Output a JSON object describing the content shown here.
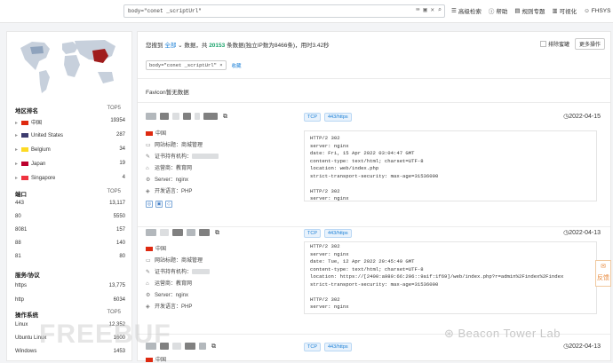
{
  "topbar": {
    "query": "body=\"conet _scriptUrl\"",
    "nav": [
      "高级检索",
      "帮助",
      "规则专题",
      "可视化",
      "FHSYS"
    ]
  },
  "sidebar": {
    "region": {
      "title": "地区排名",
      "top": "TOP5",
      "items": [
        {
          "name": "中国",
          "count": "19354",
          "flag": "#de2910"
        },
        {
          "name": "United States",
          "count": "287",
          "flag": "#3c3b6e"
        },
        {
          "name": "Belgium",
          "count": "34",
          "flag": "#fdda24"
        },
        {
          "name": "Japan",
          "count": "19",
          "flag": "#bc002d"
        },
        {
          "name": "Singapore",
          "count": "4",
          "flag": "#ef3340"
        }
      ]
    },
    "port": {
      "title": "端口",
      "top": "TOP5",
      "items": [
        {
          "name": "443",
          "count": "13,117"
        },
        {
          "name": "80",
          "count": "5550"
        },
        {
          "name": "8081",
          "count": "157"
        },
        {
          "name": "88",
          "count": "140"
        },
        {
          "name": "81",
          "count": "80"
        }
      ]
    },
    "service": {
      "title": "服务/协议",
      "items": [
        {
          "name": "https",
          "count": "13,775"
        },
        {
          "name": "http",
          "count": "6034"
        }
      ]
    },
    "os": {
      "title": "操作系统",
      "top": "TOP5",
      "items": [
        {
          "name": "Linux",
          "count": "12,352"
        },
        {
          "name": "Ubuntu Linux",
          "count": "1600"
        },
        {
          "name": "Windows",
          "count": "1453"
        }
      ]
    }
  },
  "main": {
    "summary": {
      "pre": "您搜到",
      "all": "全部",
      "mid1": "数据，共",
      "total": "20153",
      "mid2": "条数据(独立IP数为8466条)，用时3.42秒"
    },
    "exclude_label": "排除蜜罐",
    "more_btn": "更多操作",
    "chip": "body=\"conet _scriptUrl\"",
    "collect": "收藏",
    "favicon": "Favicon暂无数据",
    "cards": [
      {
        "tags": [
          "TCP",
          "443/https"
        ],
        "date": "2022-04-15",
        "country": "中国",
        "site_title": "网站标题：商城管理",
        "cert": "证书持有机构：",
        "ops": "运营商：教育网",
        "server": "Server：nginx",
        "lang": "开发语言：PHP",
        "response": "HTTP/2 302\nserver: nginx\ndate: Fri, 15 Apr 2022 03:04:47 GMT\ncontent-type: text/html; charset=UTF-8\nlocation: web/index.php\nstrict-transport-security: max-age=31536000\n\nHTTP/2 302\nserver: nginx"
      },
      {
        "tags": [
          "TCP",
          "443/https"
        ],
        "date": "2022-04-13",
        "country": "中国",
        "site_title": "网站标题：商城管理",
        "cert": "证书持有机构：",
        "ops": "运营商：教育网",
        "server": "Server：nginx",
        "lang": "开发语言：PHP",
        "response": "HTTP/2 302\nserver: nginx\ndate: Tue, 12 Apr 2022 20:45:49 GMT\ncontent-type: text/html; charset=UTF-8\nlocation: https://[2400:a980:66:206::9a1f:1f69]/web/index.php?r=admin%2Findex%2Findex\nstrict-transport-security: max-age=31536000\n\nHTTP/2 302\nserver: nginx"
      },
      {
        "tags": [
          "TCP",
          "443/https"
        ],
        "date": "2022-04-13",
        "country": "中国"
      }
    ]
  },
  "watermark": "Beacon Tower Lab",
  "watermark_logo": "FREEBUF",
  "feedback": "反馈"
}
